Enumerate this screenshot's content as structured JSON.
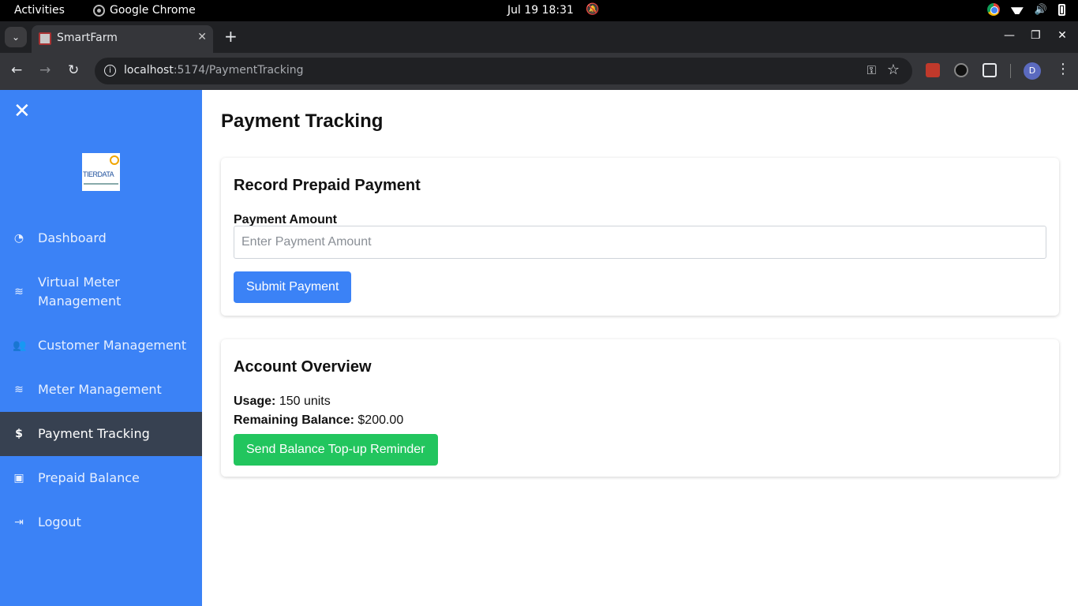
{
  "system_bar": {
    "activities": "Activities",
    "app_name": "Google Chrome",
    "clock": "Jul 19  18:31"
  },
  "browser": {
    "tab_title": "SmartFarm",
    "url_host": "localhost",
    "url_rest": ":5174/PaymentTracking",
    "profile_initial": "D"
  },
  "sidebar": {
    "items": [
      {
        "label": "Dashboard",
        "icon": "dashboard-gauge-icon"
      },
      {
        "label": "Virtual Meter",
        "label2": "Management",
        "icon": "waves-icon"
      },
      {
        "label": "Customer Management",
        "icon": "users-icon"
      },
      {
        "label": "Meter Management",
        "icon": "waves-icon"
      },
      {
        "label": "Payment Tracking",
        "icon": "dollar-icon",
        "active": true
      },
      {
        "label": "Prepaid Balance",
        "icon": "money-bill-icon"
      },
      {
        "label": "Logout",
        "icon": "sign-out-icon"
      }
    ],
    "logo_text": "TIERDATA"
  },
  "main": {
    "title": "Payment Tracking",
    "payment_card": {
      "heading": "Record Prepaid Payment",
      "amount_label": "Payment Amount",
      "amount_placeholder": "Enter Payment Amount",
      "submit_label": "Submit Payment"
    },
    "overview_card": {
      "heading": "Account Overview",
      "usage_label": "Usage:",
      "usage_value": "150 units",
      "balance_label": "Remaining Balance:",
      "balance_value": "$200.00",
      "reminder_label": "Send Balance Top-up Reminder"
    }
  },
  "colors": {
    "sidebar_bg": "#3b82f6",
    "sidebar_active_bg": "#374151",
    "primary_button": "#3b82f6",
    "success_button": "#22c55e"
  }
}
